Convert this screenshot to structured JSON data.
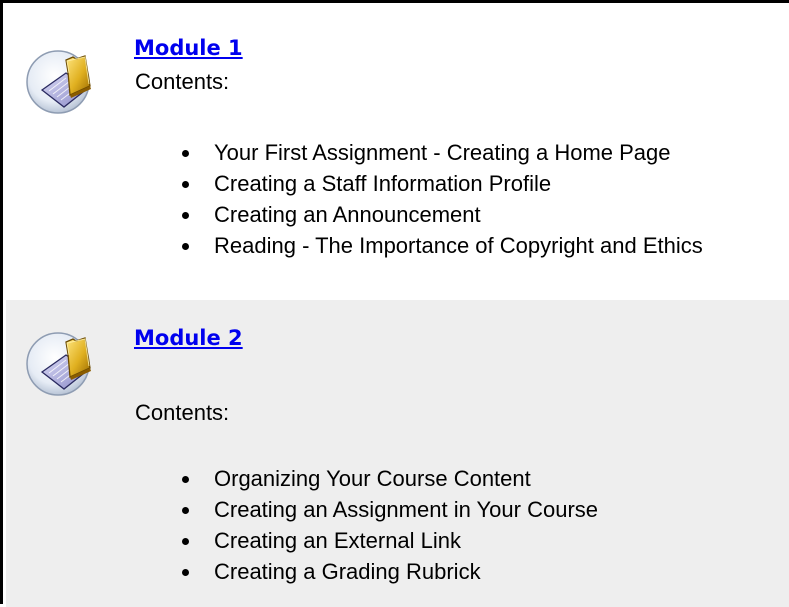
{
  "modules": [
    {
      "title": "Module 1",
      "contents_label": "Contents:",
      "icon": "folder-notebook-icon",
      "items": [
        "Your First Assignment - Creating a Home Page",
        "Creating a Staff Information Profile",
        "Creating an Announcement",
        "Reading - The Importance of Copyright and Ethics"
      ]
    },
    {
      "title": "Module 2",
      "contents_label": "Contents:",
      "icon": "folder-notebook-icon",
      "items": [
        "Organizing Your Course Content",
        "Creating an Assignment in Your Course",
        "Creating an External Link",
        "Creating a Grading Rubrick"
      ]
    }
  ],
  "colors": {
    "link": "#0000ee",
    "module_2_background": "#eeeeee",
    "frame_border": "#000000"
  }
}
